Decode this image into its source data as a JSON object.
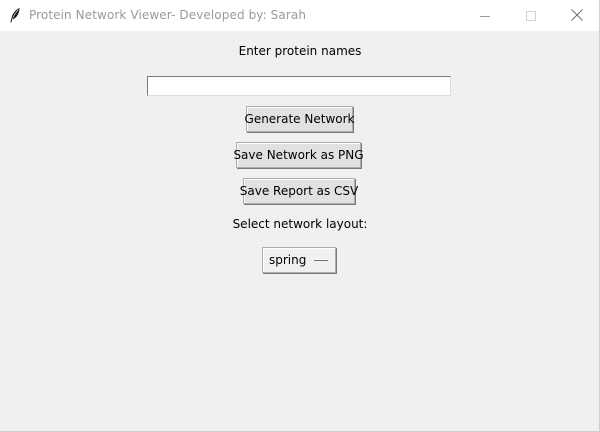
{
  "window": {
    "title": "Protein Network Viewer- Developed by: Sarah",
    "icon": "feather-icon",
    "controls": [
      "minimize-icon",
      "maximize-icon",
      "close-icon"
    ]
  },
  "form": {
    "prompt_label": "Enter protein names",
    "protein_input": {
      "value": "",
      "placeholder": ""
    },
    "generate_label": "Generate Network",
    "save_png_label": "Save Network as PNG",
    "save_csv_label": "Save Report as CSV",
    "layout_label": "Select network layout:",
    "layout_selected": "spring"
  },
  "colors": {
    "background": "#f0f0f0",
    "titlebar": "#ffffff",
    "title_text": "#9a9a9a",
    "button_face": "#e1e1e1",
    "button_border": "#adadad"
  }
}
